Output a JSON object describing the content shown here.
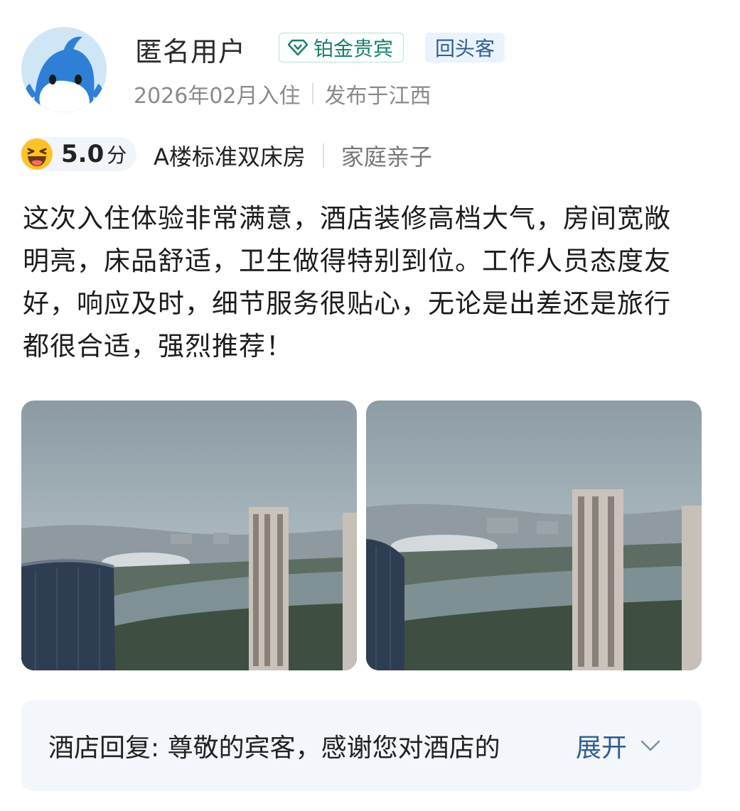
{
  "user": {
    "name": "匿名用户",
    "badges": {
      "member_level": "铂金贵宾",
      "repeat_guest": "回头客"
    },
    "stay_date": "2026年02月入住",
    "posted_from": "发布于江西"
  },
  "rating": {
    "score": "5.0",
    "unit": "分",
    "room_type": "A楼标准双床房",
    "trip_type": "家庭亲子"
  },
  "review": {
    "text": "这次入住体验非常满意，酒店装修高档大气，房间宽敞明亮，床品舒适，卫生做得特别到位。工作人员态度友好，响应及时，细节服务很贴心，无论是出差还是旅行都很合适，强烈推荐！"
  },
  "photos": [
    "photo-hotel-view-1",
    "photo-hotel-view-2"
  ],
  "reply": {
    "text": "酒店回复: 尊敬的宾客，感谢您对酒店的",
    "expand_label": "展开"
  },
  "colors": {
    "accent_blue": "#2e5f92",
    "platinum_green": "#1b7f6e",
    "reply_bg": "#f3f6fb"
  },
  "icons": [
    "dolphin-avatar",
    "diamond-icon",
    "laughing-emoji-icon",
    "chevron-down-icon"
  ]
}
